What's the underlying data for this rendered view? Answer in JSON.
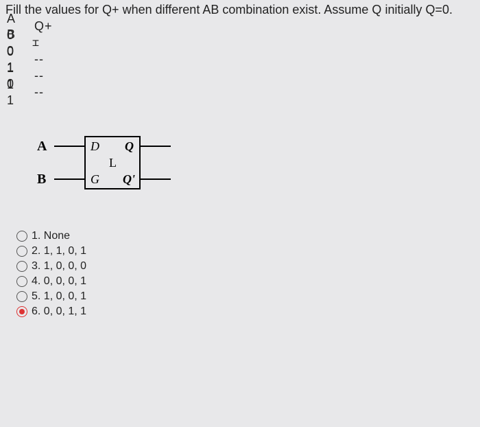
{
  "question": "Fill the values for Q+ when different AB combination exist. Assume Q initially Q=0.",
  "table": {
    "header": {
      "a": "A",
      "b": "B",
      "q": "Q+"
    },
    "rows": [
      {
        "a": "0",
        "b": "0",
        "q": "cursor"
      },
      {
        "a": "0",
        "b": "1",
        "q": "--"
      },
      {
        "a": "1",
        "b": "0",
        "q": "--"
      },
      {
        "a": "1",
        "b": "1",
        "q": "--"
      }
    ]
  },
  "latch": {
    "input_top": "A",
    "input_bottom": "B",
    "port_d": "D",
    "port_g": "G",
    "center": "L",
    "out_q": "Q",
    "out_qbar": "Q'"
  },
  "options": [
    {
      "num": "1.",
      "text": "None"
    },
    {
      "num": "2.",
      "text": "1, 1, 0, 1"
    },
    {
      "num": "3.",
      "text": "1, 0, 0, 0"
    },
    {
      "num": "4.",
      "text": "0, 0, 0, 1"
    },
    {
      "num": "5.",
      "text": "1, 0, 0, 1"
    },
    {
      "num": "6.",
      "text": "0, 0, 1, 1"
    }
  ],
  "selected_index": 5
}
